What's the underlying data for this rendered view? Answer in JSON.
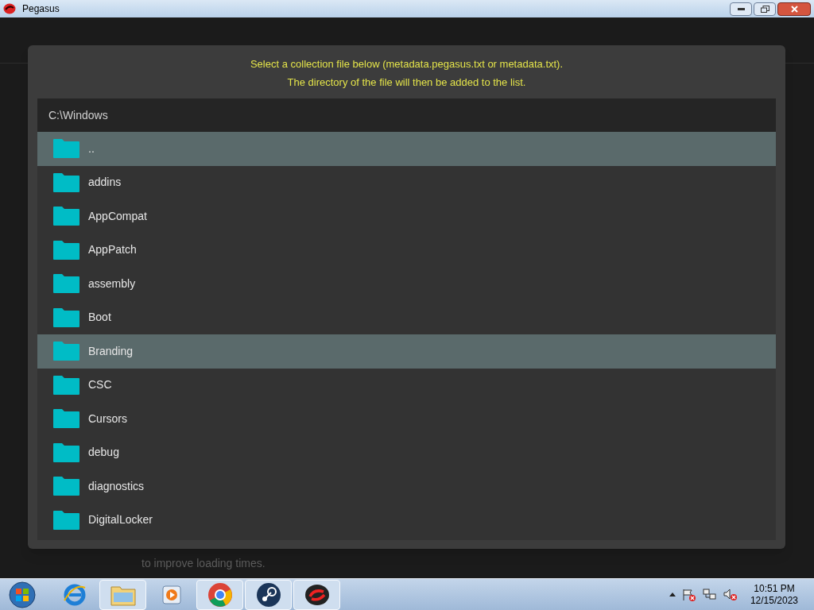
{
  "window": {
    "title": "Pegasus"
  },
  "background": {
    "description_lines": [
      "to improve loading times."
    ]
  },
  "dialog": {
    "instructions": [
      "Select a collection file below (metadata.pegasus.txt or metadata.txt).",
      "The directory of the file will then be added to the list."
    ],
    "path": "C:\\Windows",
    "entries": [
      {
        "name": "..",
        "selected": true
      },
      {
        "name": "addins",
        "selected": false
      },
      {
        "name": "AppCompat",
        "selected": false
      },
      {
        "name": "AppPatch",
        "selected": false
      },
      {
        "name": "assembly",
        "selected": false
      },
      {
        "name": "Boot",
        "selected": false
      },
      {
        "name": "Branding",
        "selected": true
      },
      {
        "name": "CSC",
        "selected": false
      },
      {
        "name": "Cursors",
        "selected": false
      },
      {
        "name": "debug",
        "selected": false
      },
      {
        "name": "diagnostics",
        "selected": false
      },
      {
        "name": "DigitalLocker",
        "selected": false
      }
    ]
  },
  "taskbar": {
    "apps": [
      {
        "kind": "browser-e",
        "active": false
      },
      {
        "kind": "folder",
        "active": true
      },
      {
        "kind": "media",
        "active": false
      },
      {
        "kind": "chrome",
        "active": true
      },
      {
        "kind": "steam",
        "active": true
      },
      {
        "kind": "pegasus",
        "active": true
      }
    ],
    "time": "10:51 PM",
    "date": "12/15/2023"
  }
}
